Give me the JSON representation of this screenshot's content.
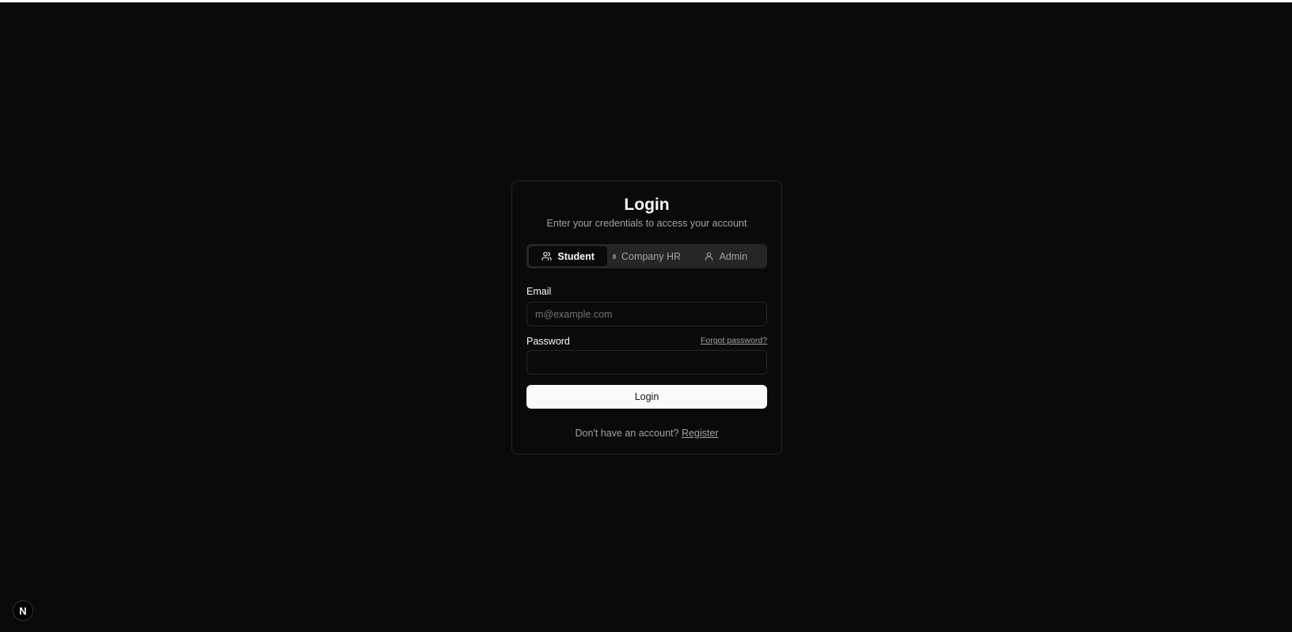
{
  "login": {
    "title": "Login",
    "subtitle": "Enter your credentials to access your account",
    "tabs": [
      {
        "label": "Student",
        "icon": "users-icon",
        "active": true
      },
      {
        "label": "Company HR",
        "icon": "building-icon",
        "active": false
      },
      {
        "label": "Admin",
        "icon": "user-icon",
        "active": false
      }
    ],
    "email_label": "Email",
    "email_placeholder": "m@example.com",
    "email_value": "",
    "password_label": "Password",
    "password_value": "",
    "forgot_password": "Forgot password?",
    "submit_label": "Login",
    "register_prompt": "Don't have an account?",
    "register_link": "Register"
  },
  "dev_badge": {
    "label": "N",
    "icon": "nextjs-icon"
  },
  "colors": {
    "background": "#0a0a0a",
    "border": "#262626",
    "primary_button": "#fafafa",
    "muted_text": "#a3a3a3"
  }
}
